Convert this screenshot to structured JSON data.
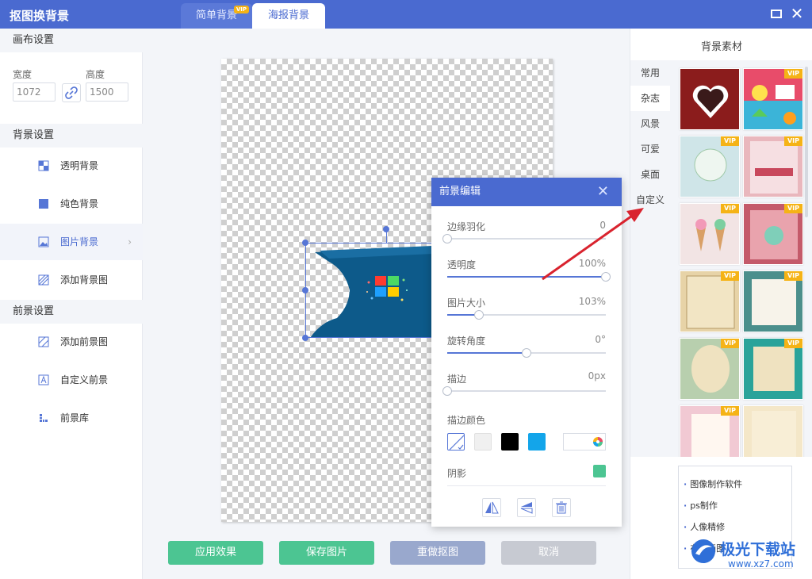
{
  "app": {
    "title": "抠图换背景"
  },
  "tabs": [
    {
      "label": "简单背景",
      "badge": "VIP"
    },
    {
      "label": "海报背景"
    }
  ],
  "left": {
    "canvas_section": "画布设置",
    "width_label": "宽度",
    "width_value": "1072",
    "height_label": "高度",
    "height_value": "1500",
    "bg_section": "背景设置",
    "bg_items": [
      "透明背景",
      "纯色背景",
      "图片背景",
      "添加背景图"
    ],
    "fg_section": "前景设置",
    "fg_items": [
      "添加前景图",
      "自定义前景",
      "前景库"
    ]
  },
  "bottom_buttons": {
    "apply": "应用效果",
    "save": "保存图片",
    "redo": "重做抠图",
    "cancel": "取消"
  },
  "right": {
    "title": "背景素材",
    "categories": [
      "常用",
      "杂志",
      "风景",
      "可爱",
      "桌面",
      "自定义"
    ],
    "vip_label": "VIP",
    "ads": [
      "图像制作软件",
      "ps制作",
      "人像精修",
      "在线画图"
    ]
  },
  "popup": {
    "title": "前景编辑",
    "feather_label": "边缘羽化",
    "feather_value": "0",
    "feather_fraction": 0.0,
    "opacity_label": "透明度",
    "opacity_value": "100%",
    "opacity_fraction": 1.0,
    "size_label": "图片大小",
    "size_value": "103%",
    "size_fraction": 0.2,
    "rotate_label": "旋转角度",
    "rotate_value": "0°",
    "rotate_fraction": 0.5,
    "stroke_label": "描边",
    "stroke_value": "0px",
    "stroke_fraction": 0.0,
    "stroke_color_label": "描边颜色",
    "shadow_label": "阴影"
  },
  "colors": {
    "accent": "#4a6ad0",
    "green": "#4cc592",
    "swatch_black": "#000000",
    "swatch_blue": "#13a5ea",
    "swatch_light": "#f0f0f0"
  },
  "watermark": {
    "text": "极光下载站",
    "url": "www.xz7.com"
  }
}
